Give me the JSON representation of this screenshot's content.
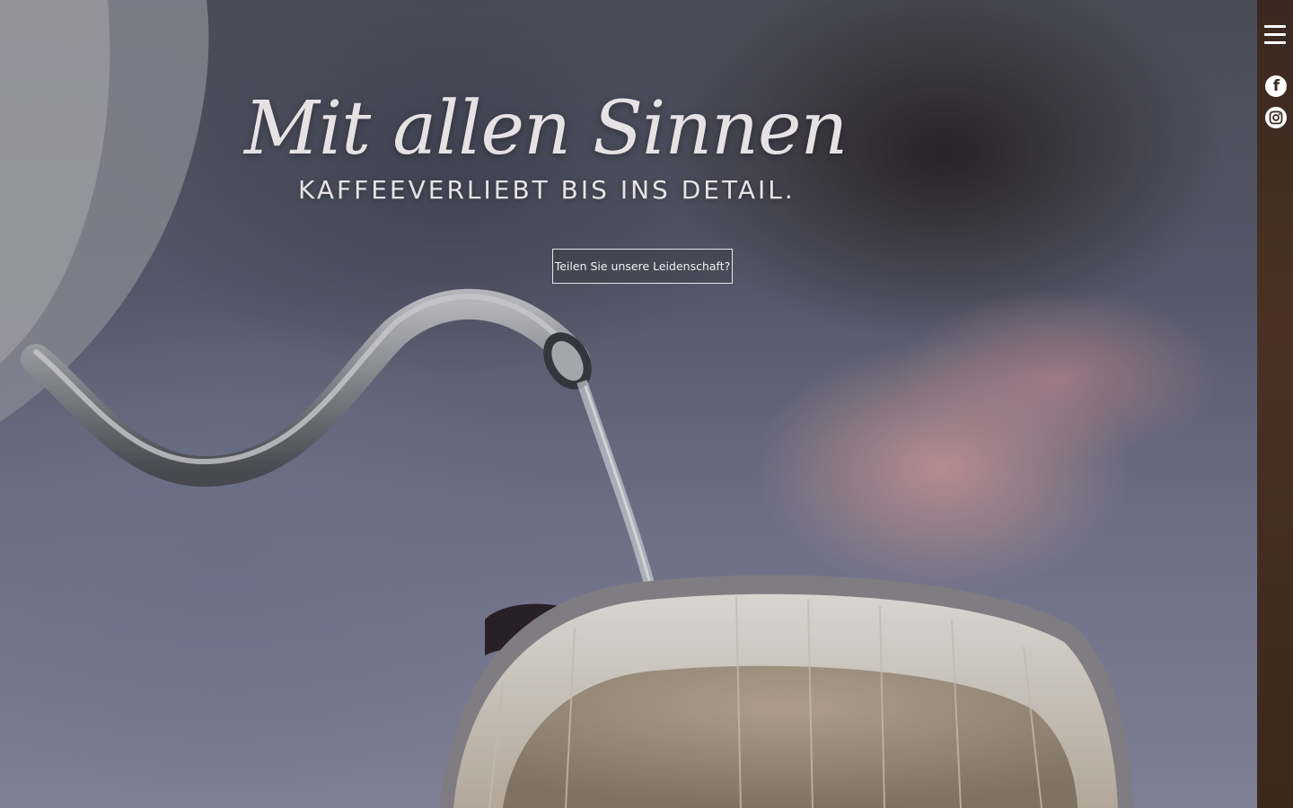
{
  "hero": {
    "headline": "Mit allen Sinnen",
    "subline": "KAFFEEVERLIEBT BIS INS DETAIL.",
    "cta_label": "Teilen Sie unsere Leidenschaft?"
  },
  "rail": {
    "menu_icon": "hamburger-icon",
    "social": [
      {
        "icon": "facebook-icon"
      },
      {
        "icon": "instagram-icon"
      }
    ]
  },
  "colors": {
    "text": "#e6e2e4",
    "rail": "#3f2a20",
    "button_border": "#e8e6ea"
  }
}
